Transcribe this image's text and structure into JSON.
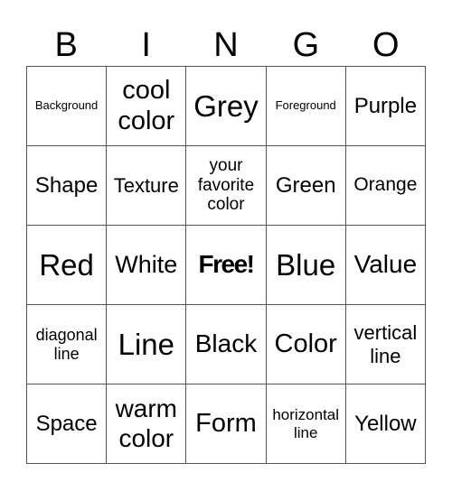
{
  "header": [
    "B",
    "I",
    "N",
    "G",
    "O"
  ],
  "cells": [
    [
      "Background",
      "cool color",
      "Grey",
      "Foreground",
      "Purple"
    ],
    [
      "Shape",
      "Texture",
      "your favorite color",
      "Green",
      "Orange"
    ],
    [
      "Red",
      "White",
      "Free!",
      "Blue",
      "Value"
    ],
    [
      "diagonal line",
      "Line",
      "Black",
      "Color",
      "vertical line"
    ],
    [
      "Space",
      "warm color",
      "Form",
      "horizontal line",
      "Yellow"
    ]
  ]
}
